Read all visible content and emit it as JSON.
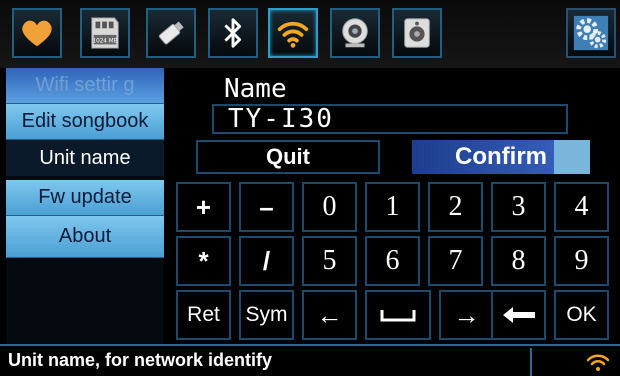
{
  "topbar": {
    "icons": [
      {
        "name": "heart-icon"
      },
      {
        "name": "sd-card-icon",
        "label": "1024 MB"
      },
      {
        "name": "usb-drive-icon"
      },
      {
        "name": "bluetooth-icon"
      },
      {
        "name": "wifi-icon"
      },
      {
        "name": "camera-icon"
      },
      {
        "name": "speaker-icon"
      },
      {
        "name": "settings-gears-icon"
      }
    ]
  },
  "menu": {
    "items": [
      {
        "label": "Wifi settir g"
      },
      {
        "label": "Edit songbook"
      },
      {
        "label": "Unit name",
        "selected": true
      },
      {
        "label": "Fw update"
      },
      {
        "label": "About"
      }
    ]
  },
  "form": {
    "name_label": "Name",
    "name_value": "TY-I30",
    "quit_label": "Quit",
    "confirm_label": "Confirm"
  },
  "keypad": {
    "rows": [
      [
        "+",
        "–",
        "0",
        "1",
        "2",
        "3",
        "4"
      ],
      [
        "*",
        "/",
        "5",
        "6",
        "7",
        "8",
        "9"
      ],
      [
        "Ret",
        "Sym",
        "←",
        "␣",
        "→",
        "⬅",
        "OK"
      ]
    ]
  },
  "status": {
    "text": "Unit name, for network identify"
  },
  "colors": {
    "accent": "#2a9dc8",
    "menu_bg": "#4a9fd3",
    "confirm_bg": "#2a52a8",
    "wifi": "#f5a623"
  }
}
